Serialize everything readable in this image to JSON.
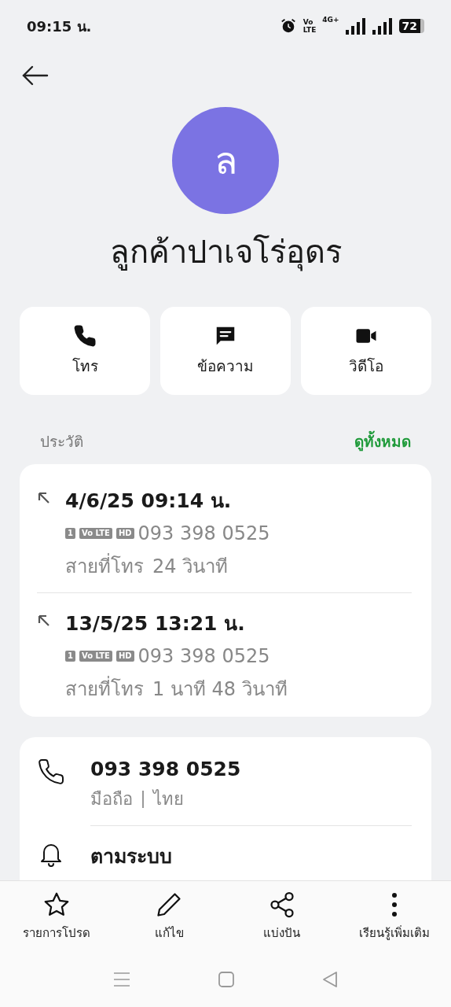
{
  "status_bar": {
    "time": "09:15 น.",
    "network_badge": [
      "Vo",
      "LTE"
    ],
    "network_type": "4G+",
    "battery": "72"
  },
  "contact": {
    "initial": "ล",
    "name": "ลูกค้าปาเจโร่อุดร"
  },
  "actions": [
    {
      "kind": "call",
      "label": "โทร"
    },
    {
      "kind": "message",
      "label": "ข้อความ"
    },
    {
      "kind": "video",
      "label": "วิดีโอ"
    }
  ],
  "history": {
    "title": "ประวัติ",
    "see_all": "ดูทั้งหมด",
    "calls": [
      {
        "time": "4/6/25 09:14 น.",
        "badges": [
          "1",
          "Vo LTE",
          "HD"
        ],
        "number": "093 398 0525",
        "duration_label": "สายที่โทร",
        "duration": "24 วินาที"
      },
      {
        "time": "13/5/25 13:21 น.",
        "badges": [
          "1",
          "Vo LTE",
          "HD"
        ],
        "number": "093 398 0525",
        "duration_label": "สายที่โทร",
        "duration": "1 นาที 48 วินาที"
      }
    ]
  },
  "details": [
    {
      "kind": "phone",
      "title": "093 398 0525",
      "subtitle": [
        "มือถือ",
        "ไทย"
      ]
    },
    {
      "kind": "ringtone",
      "title": "ตามระบบ"
    }
  ],
  "bottom_actions": [
    {
      "kind": "favorite",
      "label": "รายการโปรด"
    },
    {
      "kind": "edit",
      "label": "แก้ไข"
    },
    {
      "kind": "share",
      "label": "แบ่งปัน"
    },
    {
      "kind": "more",
      "label": "เรียนรู้เพิ่มเติม"
    }
  ]
}
